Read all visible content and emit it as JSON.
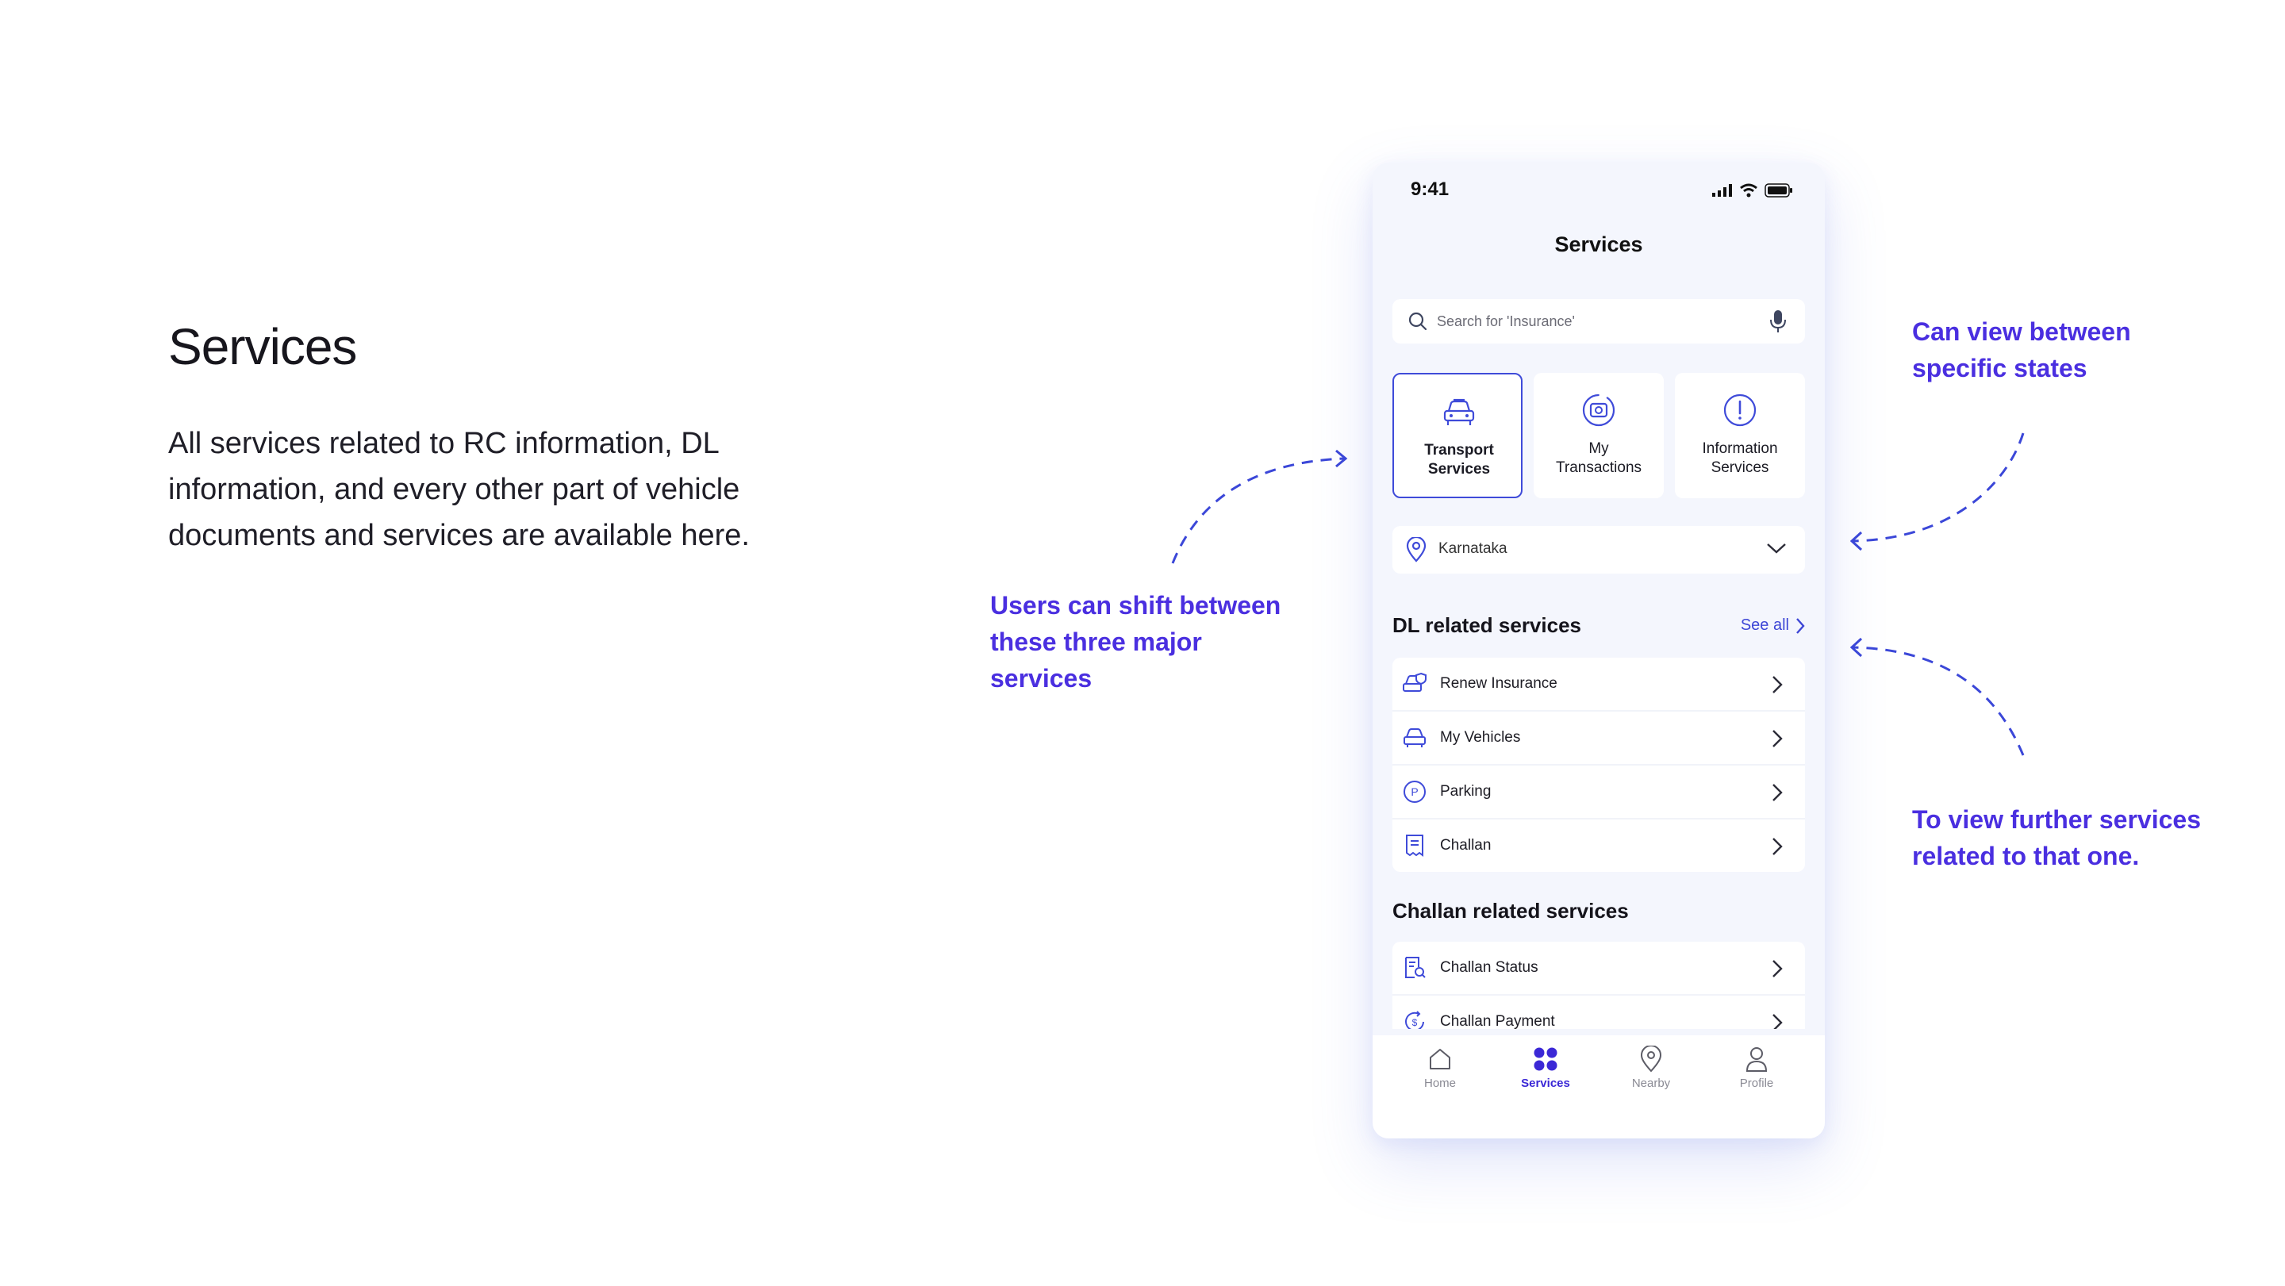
{
  "left": {
    "title": "Services",
    "description": "All services related to RC information, DL information, and every other part of vehicle documents and services are available here."
  },
  "annotations": {
    "shift": "Users can shift between these three major services",
    "states": "Can view between specific states",
    "further": "To view further services related to that one."
  },
  "phone": {
    "status_time": "9:41",
    "header_title": "Services",
    "search": {
      "placeholder": "Search for 'Insurance'",
      "icon": "search-icon",
      "mic_icon": "microphone-icon"
    },
    "tiles": [
      {
        "label": "Transport\nServices",
        "icon": "car-icon",
        "selected": true
      },
      {
        "label": "My\nTransactions",
        "icon": "transactions-icon",
        "selected": false
      },
      {
        "label": "Information\nServices",
        "icon": "info-icon",
        "selected": false
      }
    ],
    "state_selector": {
      "value": "Karnataka",
      "icon": "location-pin-icon"
    },
    "dl_section": {
      "title": "DL related services",
      "see_all": "See all",
      "items": [
        {
          "label": "Renew Insurance",
          "icon": "car-shield-icon"
        },
        {
          "label": "My Vehicles",
          "icon": "car-icon"
        },
        {
          "label": "Parking",
          "icon": "parking-icon"
        },
        {
          "label": "Challan",
          "icon": "receipt-icon"
        }
      ]
    },
    "challan_section": {
      "title": "Challan related services",
      "items": [
        {
          "label": "Challan Status",
          "icon": "document-search-icon"
        },
        {
          "label": "Challan Payment",
          "icon": "payment-icon"
        }
      ]
    },
    "bottom_nav": [
      {
        "label": "Home",
        "icon": "home-icon",
        "active": false
      },
      {
        "label": "Services",
        "icon": "grid-icon",
        "active": true
      },
      {
        "label": "Nearby",
        "icon": "location-pin-icon",
        "active": false
      },
      {
        "label": "Profile",
        "icon": "user-icon",
        "active": false
      }
    ]
  },
  "colors": {
    "accent": "#4a2fe0",
    "primary_blue": "#3f4bd9",
    "phone_bg": "#f4f6fd"
  }
}
